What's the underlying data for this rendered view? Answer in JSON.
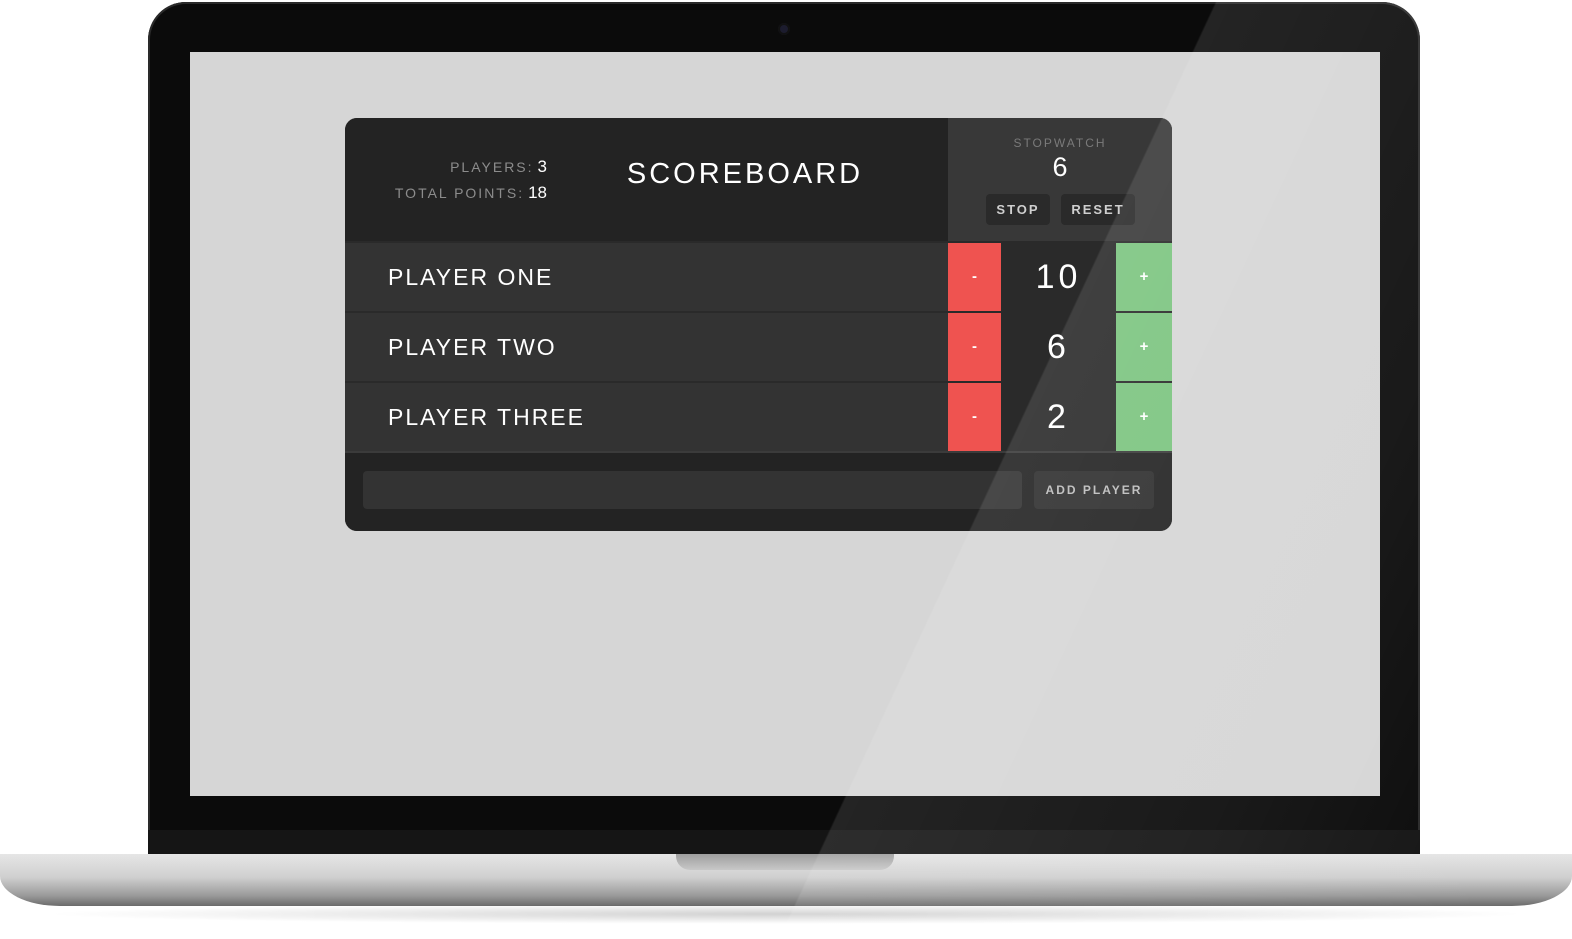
{
  "header": {
    "players_label": "PLAYERS:",
    "players_count": "3",
    "total_points_label": "TOTAL POINTS:",
    "total_points": "18",
    "title": "SCOREBOARD"
  },
  "stopwatch": {
    "label": "STOPWATCH",
    "time": "6",
    "stop_label": "STOP",
    "reset_label": "RESET"
  },
  "players": [
    {
      "name": "PLAYER ONE",
      "score": "10",
      "decrement_label": "-",
      "increment_label": "+"
    },
    {
      "name": "PLAYER TWO",
      "score": "6",
      "decrement_label": "-",
      "increment_label": "+"
    },
    {
      "name": "PLAYER THREE",
      "score": "2",
      "decrement_label": "-",
      "increment_label": "+"
    }
  ],
  "add_player": {
    "input_value": "",
    "button_label": "ADD PLAYER"
  },
  "colors": {
    "decrement": "#ef5350",
    "increment": "#7bc47f",
    "panel": "#2c2c2c",
    "screen_background": "#d6d6d6"
  }
}
